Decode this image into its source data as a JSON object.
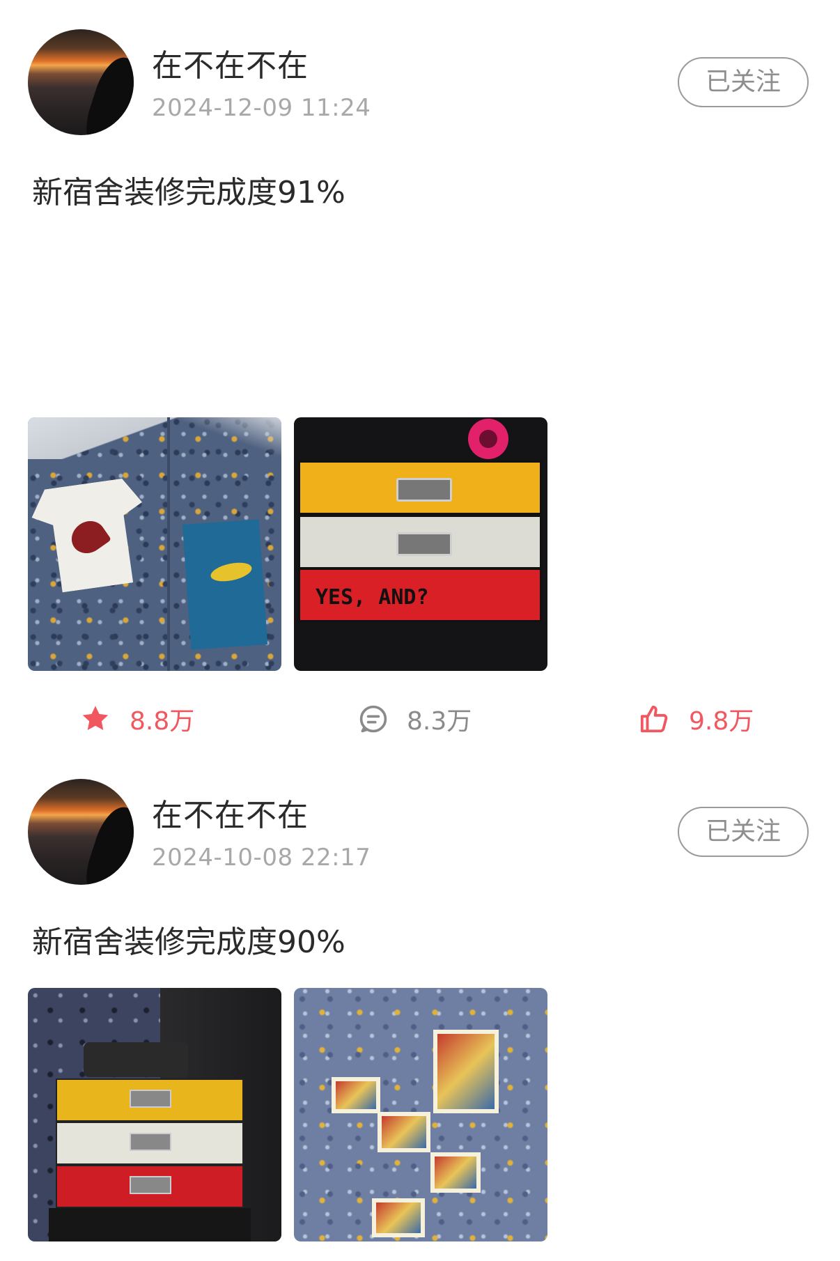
{
  "posts": [
    {
      "username": "在不在不在",
      "timestamp": "2024-12-09 11:24",
      "follow_label": "已关注",
      "text": "新宿舍装修完成度91%",
      "stats": {
        "favorites": "8.8万",
        "comments": "8.3万",
        "likes": "9.8万"
      },
      "images": [
        "wallpaper-corner-photo",
        "drawer-stack-photo"
      ]
    },
    {
      "username": "在不在不在",
      "timestamp": "2024-10-08 22:17",
      "follow_label": "已关注",
      "text": "新宿舍装修完成度90%",
      "images": [
        "drawer-cabinet-photo",
        "comic-wall-photo"
      ]
    }
  ],
  "drawer_photo_text": "YES, AND?",
  "icons": {
    "favorite": "star-icon",
    "comment": "comment-icon",
    "like": "thumbs-up-icon"
  },
  "colors": {
    "accent": "#f0575f",
    "muted": "#8a8a8a",
    "border": "#9a9a9a"
  }
}
